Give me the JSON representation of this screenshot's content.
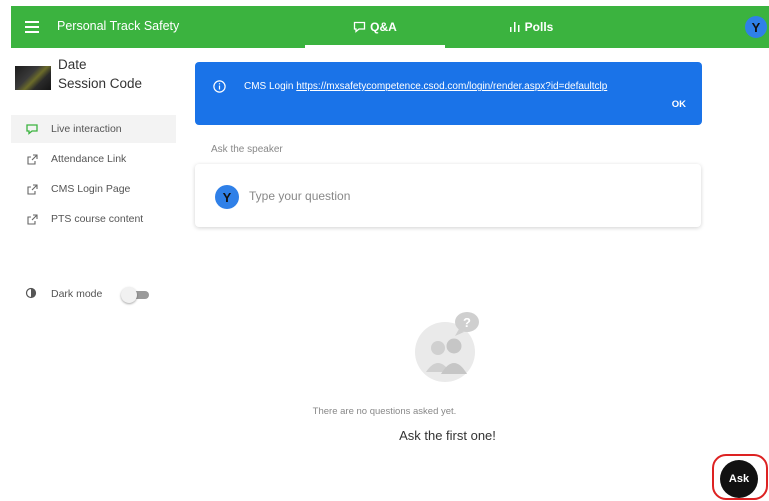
{
  "header": {
    "app_title": "Personal Track Safety",
    "tabs": [
      {
        "label": "Q&A",
        "icon": "chat-bubble-icon",
        "active": true
      },
      {
        "label": "Polls",
        "icon": "poll-bars-icon",
        "active": false
      }
    ],
    "user_initial": "Y",
    "bar_color": "#3bb33f"
  },
  "sidebar": {
    "event_date": "Date",
    "session_code": "Session Code",
    "items": [
      {
        "label": "Live interaction",
        "icon": "chat-bubble-icon",
        "active": true
      },
      {
        "label": "Attendance Link",
        "icon": "external-link-icon"
      },
      {
        "label": "CMS Login Page",
        "icon": "external-link-icon"
      },
      {
        "label": "PTS course content",
        "icon": "external-link-icon"
      }
    ],
    "dark_mode_label": "Dark mode",
    "dark_mode_on": false
  },
  "banner": {
    "prefix": "CMS Login",
    "link": "https://mxsafetycompetence.csod.com/login/render.aspx?id=defaultclp",
    "ok_label": "OK",
    "color": "#1a73e8"
  },
  "ask": {
    "section_label": "Ask the speaker",
    "avatar_initial": "Y",
    "placeholder": "Type your question"
  },
  "empty_state": {
    "line1": "There are no questions asked yet.",
    "line2": "Ask the first one!"
  },
  "ask_button_label": "Ask"
}
